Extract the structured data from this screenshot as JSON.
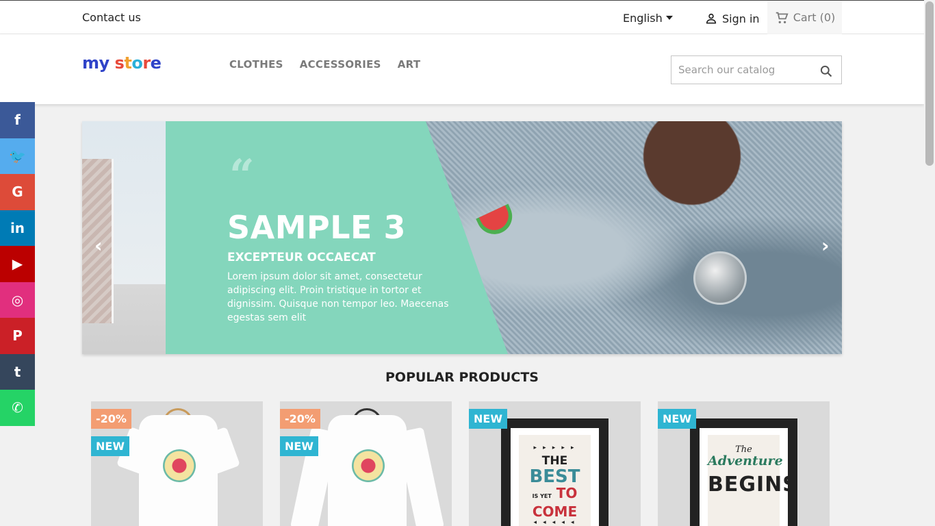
{
  "topbar": {
    "contact": "Contact us",
    "language": "English",
    "sign_in": "Sign in",
    "cart": "Cart (0)"
  },
  "header": {
    "logo_text": [
      "m",
      "y",
      " ",
      "s",
      "t",
      "o",
      "r",
      "e"
    ],
    "menu": [
      "CLOTHES",
      "ACCESSORIES",
      "ART"
    ],
    "search_placeholder": "Search our catalog"
  },
  "social": [
    {
      "name": "facebook",
      "glyph": "f",
      "color": "#3b5998"
    },
    {
      "name": "twitter",
      "glyph": "🐦",
      "color": "#55acee"
    },
    {
      "name": "google",
      "glyph": "G",
      "color": "#dd4b39"
    },
    {
      "name": "linkedin",
      "glyph": "in",
      "color": "#007bb5"
    },
    {
      "name": "youtube",
      "glyph": "▶",
      "color": "#bb0000"
    },
    {
      "name": "instagram",
      "glyph": "◎",
      "color": "#e12f7e"
    },
    {
      "name": "pinterest",
      "glyph": "P",
      "color": "#cb2027"
    },
    {
      "name": "tumblr",
      "glyph": "t",
      "color": "#35465c"
    },
    {
      "name": "whatsapp",
      "glyph": "✆",
      "color": "#25d366"
    }
  ],
  "slider": {
    "title": "SAMPLE 3",
    "subtitle": "EXCEPTEUR OCCAECAT",
    "body": "Lorem ipsum dolor sit amet, consectetur adipiscing elit. Proin tristique in tortor et dignissim. Quisque non tempor leo. Maecenas egestas sem elit",
    "prev": "‹",
    "next": "›"
  },
  "popular_title": "POPULAR PRODUCTS",
  "products": [
    {
      "discount": "-20%",
      "badge": "NEW"
    },
    {
      "discount": "-20%",
      "badge": "NEW"
    },
    {
      "badge": "NEW",
      "poster": {
        "top": "▸ ▸ ▸ ▸ ▸",
        "the": "THE",
        "best": "BEST",
        "yet": "IS YET",
        "to": "TO",
        "come": "COME",
        "bottom": "◂ ◂ ◂ ◂ ◂"
      }
    },
    {
      "badge": "NEW",
      "poster": {
        "line1": "The",
        "line2": "Adventure",
        "line3": "BEGINS"
      }
    }
  ],
  "colors": {
    "accent": "#2fb5d2",
    "discount": "#f39d72",
    "slide_teal": "#84d6bc"
  }
}
